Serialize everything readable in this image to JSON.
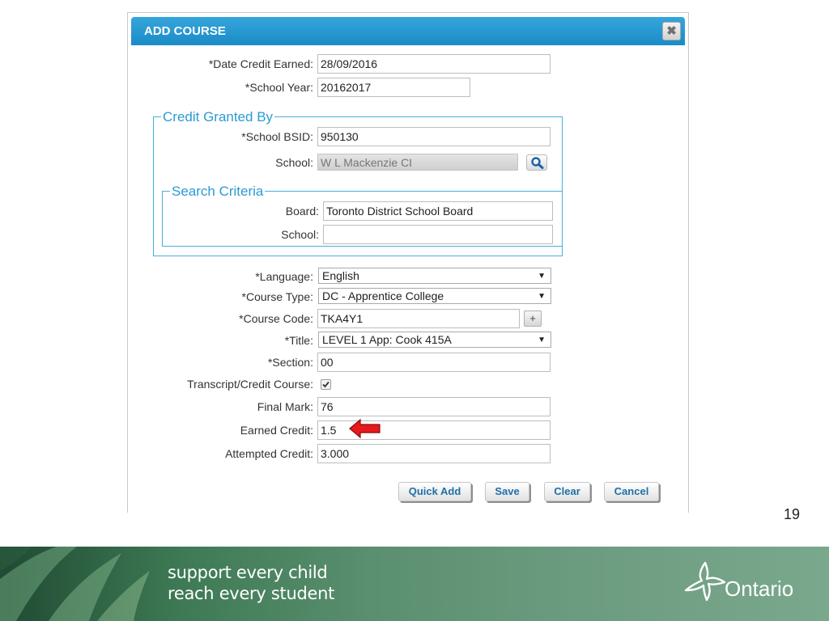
{
  "dialog": {
    "title": "ADD COURSE",
    "close_glyph": "✖"
  },
  "fields": {
    "date_credit_earned": {
      "label": "*Date Credit Earned:",
      "value": "28/09/2016"
    },
    "school_year": {
      "label": "*School Year:",
      "value": "20162017"
    }
  },
  "credit_granted_by": {
    "legend": "Credit Granted By",
    "school_bsid": {
      "label": "*School BSID:",
      "value": "950130"
    },
    "school": {
      "label": "School:",
      "value": "W L Mackenzie CI"
    }
  },
  "search_criteria": {
    "legend": "Search Criteria",
    "board": {
      "label": "Board:",
      "value": "Toronto District School Board"
    },
    "school": {
      "label": "School:",
      "value": ""
    }
  },
  "course": {
    "language": {
      "label": "*Language:",
      "value": "English"
    },
    "course_type": {
      "label": "*Course Type:",
      "value": "DC - Apprentice College"
    },
    "course_code": {
      "label": "*Course Code:",
      "value": "TKA4Y1",
      "add_glyph": "+"
    },
    "title": {
      "label": "*Title:",
      "value": "LEVEL 1 App: Cook 415A"
    },
    "section": {
      "label": "*Section:",
      "value": "00"
    },
    "transcript_credit_course": {
      "label": "Transcript/Credit Course:",
      "checked": true
    },
    "final_mark": {
      "label": "Final Mark:",
      "value": "76"
    },
    "earned_credit": {
      "label": "Earned Credit:",
      "value": "1.5"
    },
    "attempted_credit": {
      "label": "Attempted Credit:",
      "value": "3.000"
    }
  },
  "buttons": {
    "quick_add": "Quick Add",
    "save": "Save",
    "clear": "Clear",
    "cancel": "Cancel"
  },
  "page_number": "19",
  "footer": {
    "slogan_line1": "support every child",
    "slogan_line2": "reach every student",
    "logo_text": "Ontario"
  },
  "colors": {
    "titlebar": "#1b8bc6",
    "legend_text": "#2c9ad5",
    "button_text": "#1f6fa8",
    "arrow": "#e8191c",
    "footer_green": "#3e7a55"
  }
}
